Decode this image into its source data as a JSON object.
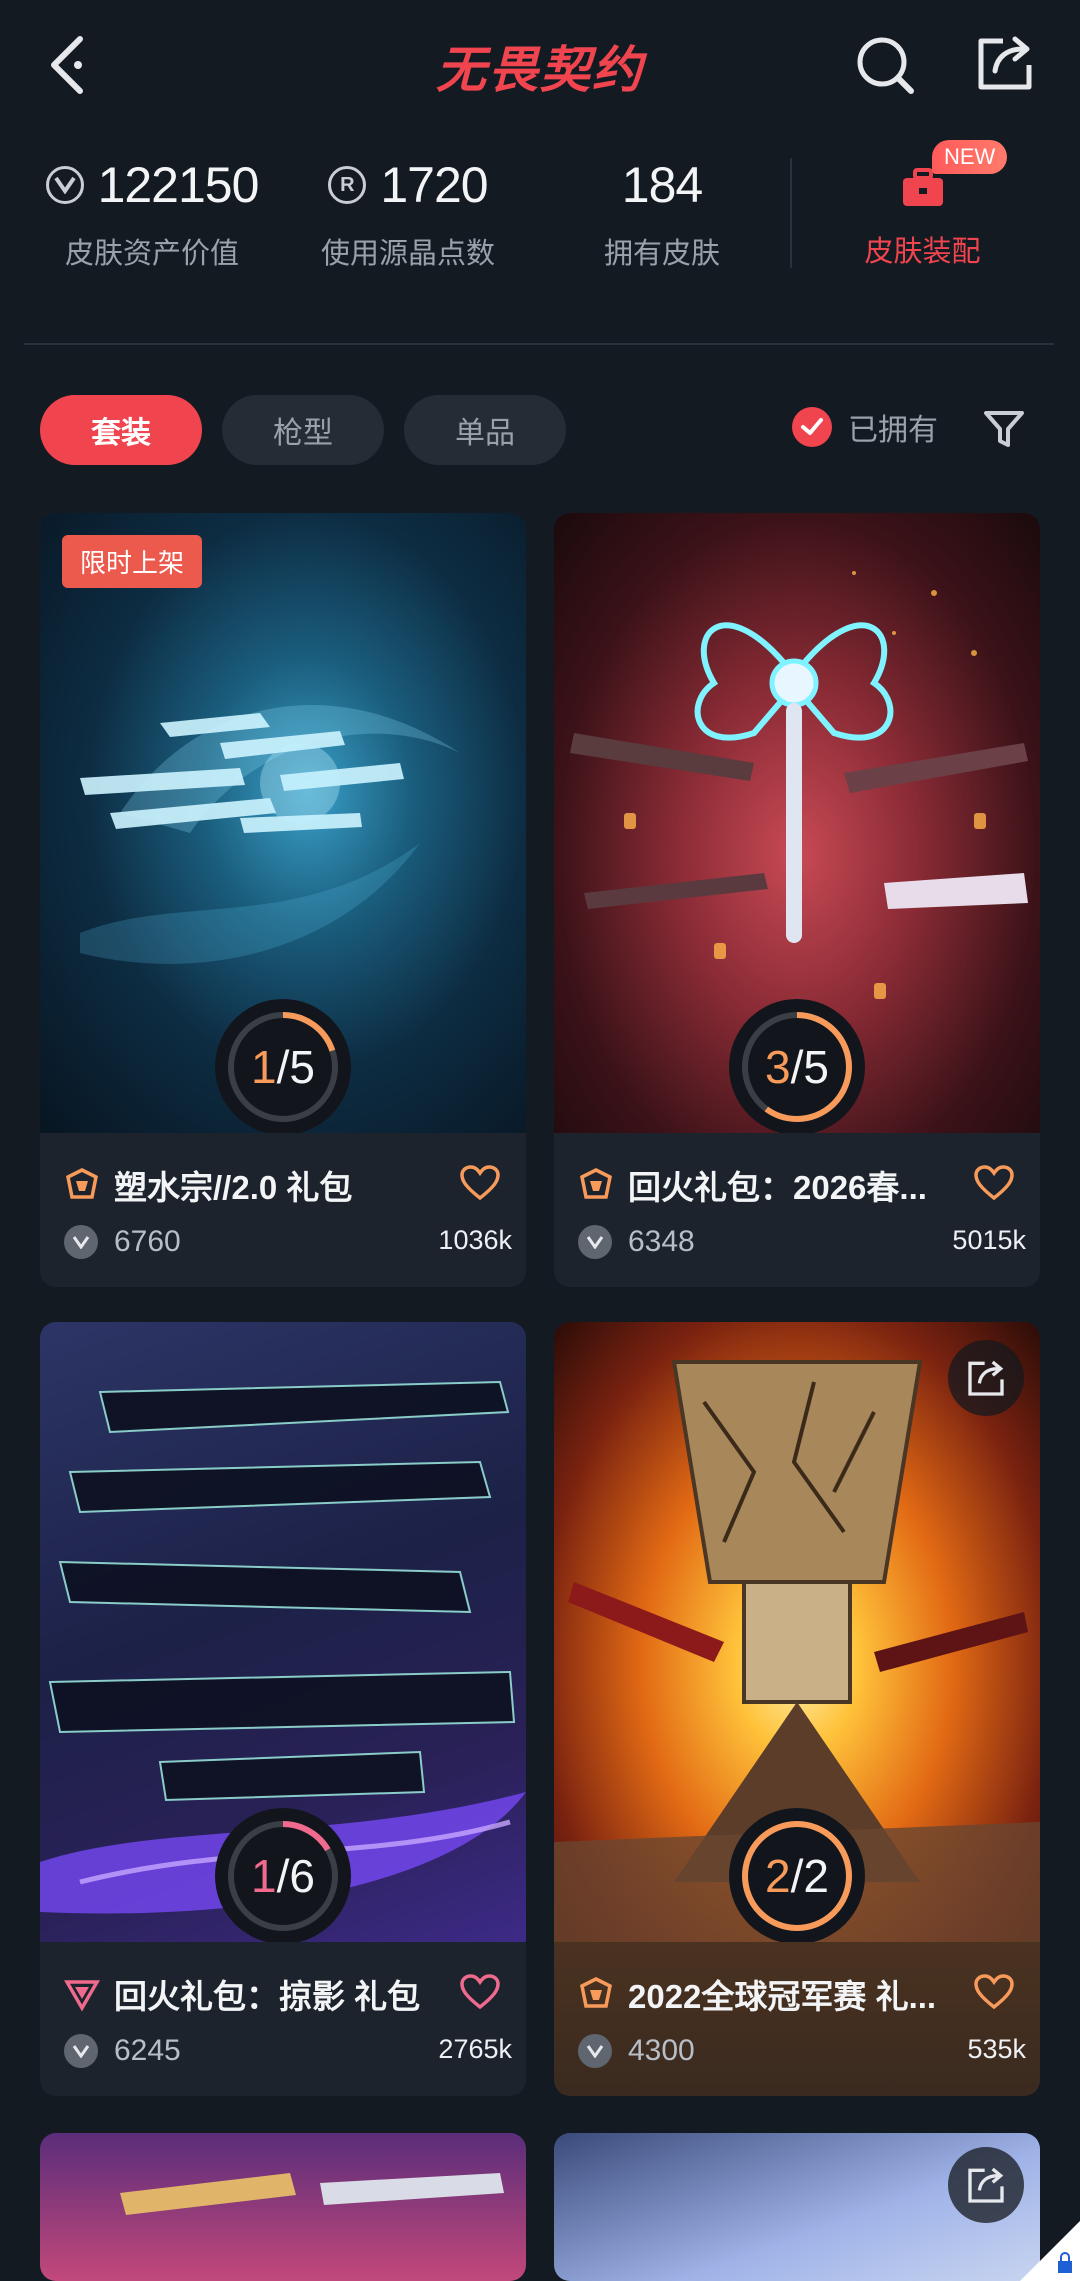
{
  "header": {
    "title": "无畏契约",
    "icons": {
      "back": "back-arrow-icon",
      "search": "search-icon",
      "share": "share-icon"
    }
  },
  "stats": {
    "skin_value": {
      "value": "122150",
      "label": "皮肤资产价值"
    },
    "radianite": {
      "value": "1720",
      "label": "使用源晶点数"
    },
    "owned_skins": {
      "value": "184",
      "label": "拥有皮肤"
    },
    "equip": {
      "label": "皮肤装配",
      "badge": "NEW"
    }
  },
  "tabs": [
    {
      "label": "套装",
      "active": true
    },
    {
      "label": "枪型",
      "active": false
    },
    {
      "label": "单品",
      "active": false
    }
  ],
  "filter": {
    "owned_label": "已拥有",
    "owned_checked": true
  },
  "colors": {
    "accent": "#f0454f",
    "background": "#141a22",
    "card": "#1c232d",
    "progress_orange": "#f79a5a",
    "progress_pink": "#ef6a8d"
  },
  "cards": [
    {
      "name": "塑水宗//2.0 礼包",
      "price": "6760",
      "likes": "1036k",
      "owned": "1",
      "total": "5",
      "tag": "限时上架",
      "tier": "orange"
    },
    {
      "name": "回火礼包：2026春...",
      "price": "6348",
      "likes": "5015k",
      "owned": "3",
      "total": "5",
      "tier": "orange"
    },
    {
      "name": "回火礼包：掠影 礼包",
      "price": "6245",
      "likes": "2765k",
      "owned": "1",
      "total": "6",
      "tier": "pink"
    },
    {
      "name": "2022全球冠军赛 礼...",
      "price": "4300",
      "likes": "535k",
      "owned": "2",
      "total": "2",
      "tier": "orange"
    }
  ]
}
